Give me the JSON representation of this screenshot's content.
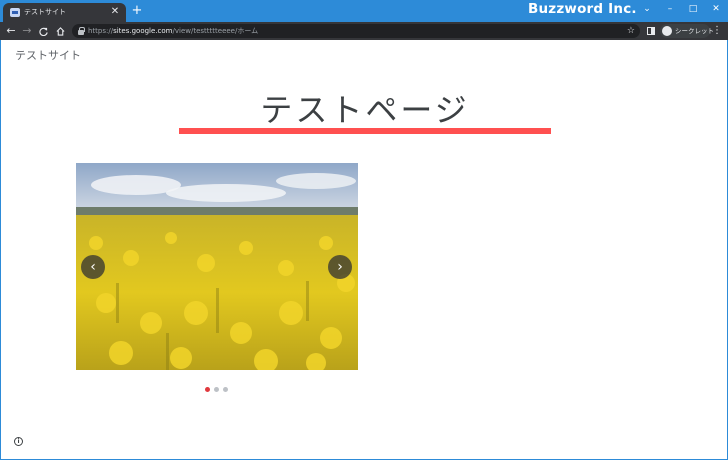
{
  "window": {
    "brand": "Buzzword Inc.",
    "controls": {
      "dropdown": "⌄",
      "minimize": "–",
      "maximize": "□",
      "close": "✕"
    }
  },
  "tab": {
    "title": "テストサイト",
    "close": "✕",
    "new_tab": "+"
  },
  "toolbar": {
    "back": "←",
    "forward": "→",
    "reload": "C",
    "home": "⌂",
    "url_scheme": "https://",
    "url_host": "sites.google.com",
    "url_path": "/view/testtttteeee/ホーム",
    "star": "☆",
    "incognito_label": "シークレット",
    "menu": "⋮"
  },
  "page": {
    "site_name": "テストサイト",
    "title": "テストページ",
    "accent_color": "#ff5050"
  },
  "carousel": {
    "image": "rapeseed-field-photo",
    "prev": "‹",
    "next": "›",
    "slide_count": 3,
    "active_index": 0
  },
  "footer": {
    "info_icon": "i"
  }
}
